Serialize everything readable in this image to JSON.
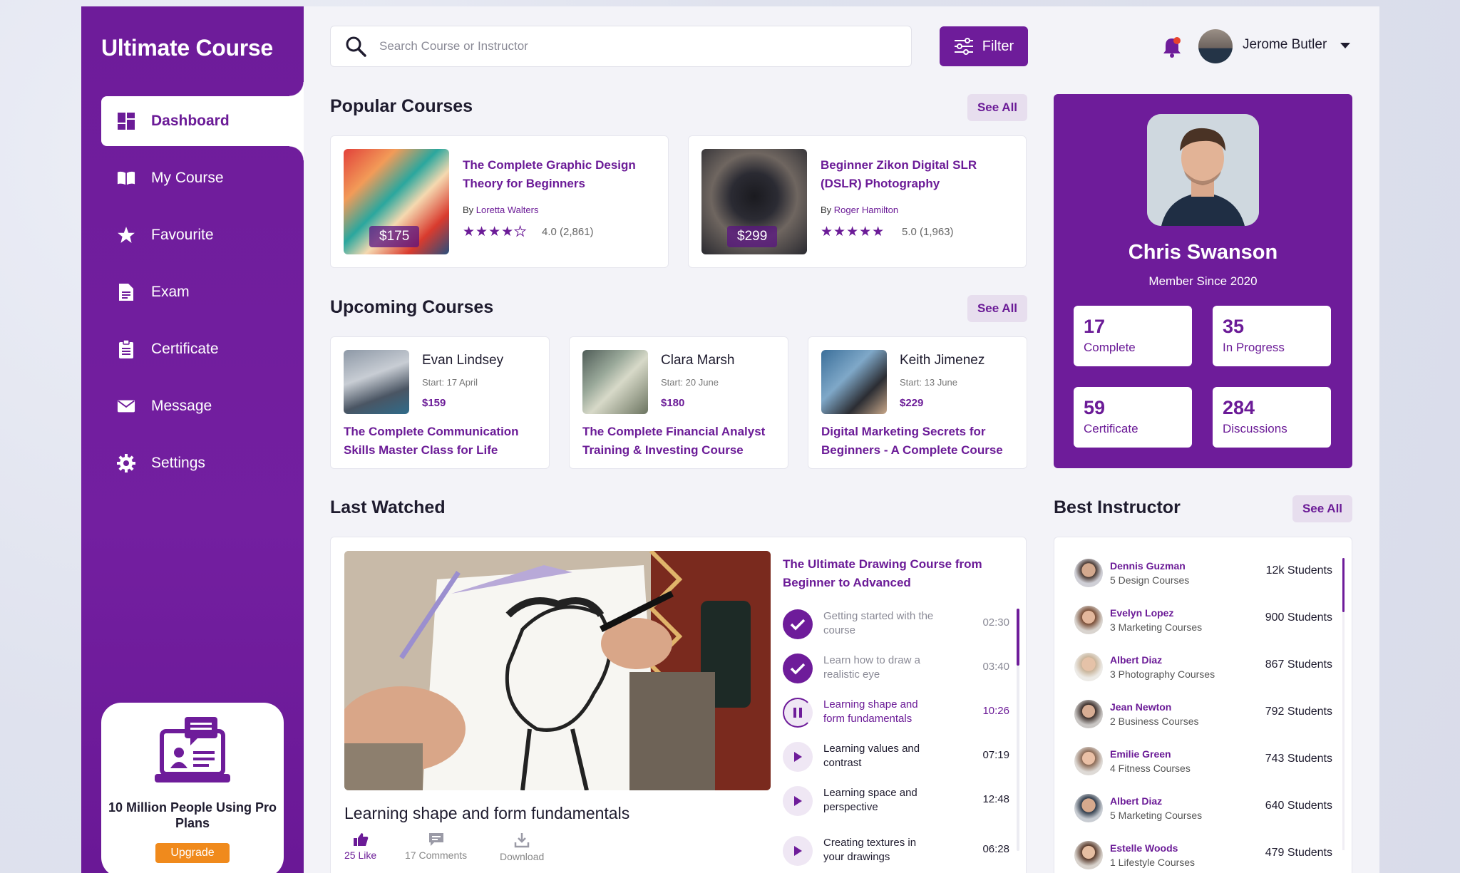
{
  "app": {
    "logo": "Ultimate Course"
  },
  "sidebar": {
    "items": [
      {
        "label": "Dashboard",
        "icon": "dashboard-icon",
        "active": true
      },
      {
        "label": "My Course",
        "icon": "book-icon"
      },
      {
        "label": "Favourite",
        "icon": "star-icon"
      },
      {
        "label": "Exam",
        "icon": "document-icon"
      },
      {
        "label": "Certificate",
        "icon": "clipboard-icon"
      },
      {
        "label": "Message",
        "icon": "envelope-icon"
      },
      {
        "label": "Settings",
        "icon": "gear-icon"
      }
    ],
    "promo": {
      "text": "10 Million People Using Pro Plans",
      "button": "Upgrade"
    }
  },
  "header": {
    "search_placeholder": "Search Course or Instructor",
    "filter_label": "Filter",
    "user_name": "Jerome Butler"
  },
  "popular": {
    "title": "Popular Courses",
    "see_all": "See All",
    "courses": [
      {
        "title": "The Complete Graphic Design Theory for Beginners",
        "by": "By",
        "author": "Loretta Walters",
        "price": "$175",
        "rating": "4.0 (2,861)",
        "stars": 4
      },
      {
        "title": "Beginner Zikon Digital SLR (DSLR) Photography",
        "by": "By",
        "author": "Roger Hamilton",
        "price": "$299",
        "rating": "5.0 (1,963)",
        "stars": 5
      }
    ]
  },
  "upcoming": {
    "title": "Upcoming Courses",
    "see_all": "See All",
    "courses": [
      {
        "instructor": "Evan Lindsey",
        "start": "Start: 17 April",
        "price": "$159",
        "title": "The Complete Communication Skills Master Class for Life"
      },
      {
        "instructor": "Clara Marsh",
        "start": "Start: 20 June",
        "price": "$180",
        "title": "The Complete Financial Analyst Training & Investing Course"
      },
      {
        "instructor": "Keith Jimenez",
        "start": "Start: 13 June",
        "price": "$229",
        "title": "Digital Marketing Secrets for Beginners - A Complete Course"
      }
    ]
  },
  "profile": {
    "name": "Chris Swanson",
    "since": "Member Since 2020",
    "stats": [
      {
        "num": "17",
        "label": "Complete"
      },
      {
        "num": "35",
        "label": "In Progress"
      },
      {
        "num": "59",
        "label": "Certificate"
      },
      {
        "num": "284",
        "label": "Discussions"
      }
    ]
  },
  "last_watched": {
    "title": "Last Watched",
    "video_caption": "Learning shape and form fundamentals",
    "actions": [
      {
        "label": "25 Like",
        "icon": "thumbs-up-icon"
      },
      {
        "label": "17 Comments",
        "icon": "comment-icon"
      },
      {
        "label": "Download",
        "icon": "download-icon"
      }
    ],
    "course_title": "The Ultimate Drawing Course from Beginner to Advanced",
    "lessons": [
      {
        "title": "Getting started with the course",
        "duration": "02:30",
        "state": "done"
      },
      {
        "title": "Learn how to draw a realistic eye",
        "duration": "03:40",
        "state": "done"
      },
      {
        "title": "Learning shape and form fundamentals",
        "duration": "10:26",
        "state": "playing"
      },
      {
        "title": "Learning values and contrast",
        "duration": "07:19",
        "state": "todo"
      },
      {
        "title": "Learning space and perspective",
        "duration": "12:48",
        "state": "todo"
      },
      {
        "title": "Creating textures in your drawings",
        "duration": "06:28",
        "state": "todo"
      }
    ]
  },
  "instructors": {
    "title": "Best Instructor",
    "see_all": "See All",
    "list": [
      {
        "name": "Dennis Guzman",
        "courses": "5 Design Courses",
        "students": "12k Students"
      },
      {
        "name": "Evelyn Lopez",
        "courses": "3 Marketing Courses",
        "students": "900 Students"
      },
      {
        "name": "Albert Diaz",
        "courses": "3 Photography Courses",
        "students": "867 Students"
      },
      {
        "name": "Jean Newton",
        "courses": "2 Business Courses",
        "students": "792 Students"
      },
      {
        "name": "Emilie Green",
        "courses": "4 Fitness Courses",
        "students": "743 Students"
      },
      {
        "name": "Albert Diaz",
        "courses": "5 Marketing Courses",
        "students": "640 Students"
      },
      {
        "name": "Estelle Woods",
        "courses": "1 Lifestyle Courses",
        "students": "479 Students"
      }
    ]
  },
  "colors": {
    "primary": "#6e1c9a",
    "accent": "#f08a1c",
    "notification": "#e8432e"
  }
}
